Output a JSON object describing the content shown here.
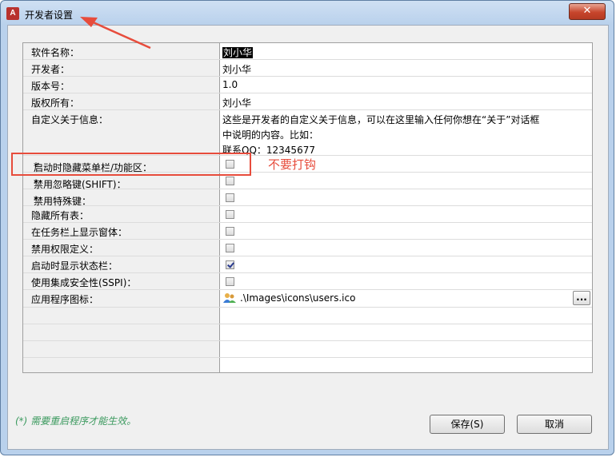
{
  "window": {
    "title": "开发者设置",
    "close_label": "✕",
    "app_icon_text": "A"
  },
  "properties": [
    {
      "label": "软件名称：",
      "type": "text",
      "value": "刘小华",
      "selected": true,
      "required": false
    },
    {
      "label": "开发者：",
      "type": "text",
      "value": "刘小华",
      "required": false
    },
    {
      "label": "版本号：",
      "type": "text",
      "value": "1.0",
      "required": false
    },
    {
      "label": "版权所有：",
      "type": "text",
      "value": "刘小华",
      "required": false
    },
    {
      "label": "自定义关于信息：",
      "type": "multiline",
      "lines": [
        "这些是开发者的自定义关于信息，可以在这里输入任何你想在“关于”对话框",
        "中说明的内容。比如：",
        "联系QQ：12345677"
      ],
      "required": false
    },
    {
      "label": "启动时隐藏菜单栏/功能区：",
      "type": "checkbox",
      "checked": false,
      "required": true
    },
    {
      "label": "禁用忽略键(SHIFT)：",
      "type": "checkbox",
      "checked": false,
      "required": true
    },
    {
      "label": "禁用特殊键：",
      "type": "checkbox",
      "checked": false,
      "required": true
    },
    {
      "label": "隐藏所有表：",
      "type": "checkbox",
      "checked": false,
      "required": false
    },
    {
      "label": "在任务栏上显示窗体：",
      "type": "checkbox",
      "checked": false,
      "required": false
    },
    {
      "label": "禁用权限定义：",
      "type": "checkbox",
      "checked": false,
      "required": false
    },
    {
      "label": "启动时显示状态栏：",
      "type": "checkbox",
      "checked": true,
      "required": false
    },
    {
      "label": "使用集成安全性(SSPI)：",
      "type": "checkbox",
      "checked": false,
      "required": false
    },
    {
      "label": "应用程序图标：",
      "type": "icon-path",
      "value": ".\\Images\\icons\\users.ico",
      "browse_label": "...",
      "required": false
    }
  ],
  "required_marker": "*",
  "annotation": {
    "text": "不要打钩",
    "color": "#e74c3c"
  },
  "footer": {
    "note": "(*) 需要重启程序才能生效。",
    "save_label": "保存(S)",
    "cancel_label": "取消"
  }
}
